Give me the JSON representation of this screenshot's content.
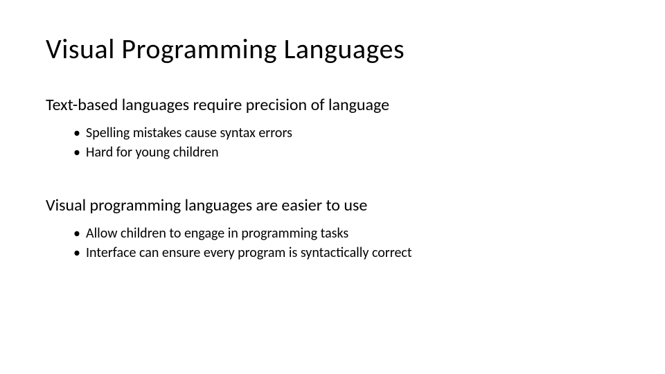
{
  "title": "Visual Programming Languages",
  "sections": [
    {
      "heading": "Text-based languages require precision of language",
      "bullets": [
        "Spelling mistakes cause syntax errors",
        "Hard for young children"
      ]
    },
    {
      "heading": "Visual programming languages are easier to use",
      "bullets": [
        "Allow children to engage in programming tasks",
        "Interface can ensure every program is syntactically correct"
      ]
    }
  ]
}
